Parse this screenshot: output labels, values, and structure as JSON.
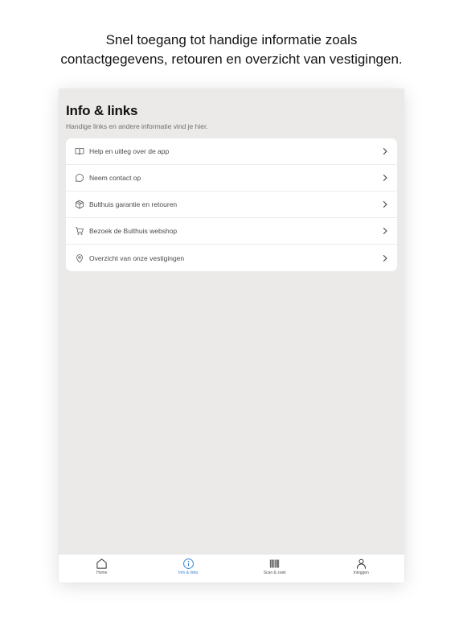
{
  "caption": {
    "line1": "Snel toegang tot handige informatie zoals",
    "line2": "contactgegevens, retouren en overzicht van vestigingen."
  },
  "page": {
    "title": "Info & links",
    "subtitle": "Handige links en andere informatie vind je hier."
  },
  "menu": {
    "items": [
      {
        "label": "Help en uitleg over de app",
        "icon": "book-icon"
      },
      {
        "label": "Neem contact op",
        "icon": "chat-bubble-icon"
      },
      {
        "label": "Bulthuis garantie en retouren",
        "icon": "package-icon"
      },
      {
        "label": "Bezoek de Bulthuis webshop",
        "icon": "cart-icon"
      },
      {
        "label": "Overzicht van onze vestigingen",
        "icon": "location-pin-icon"
      }
    ]
  },
  "tabbar": {
    "tabs": [
      {
        "label": "Home",
        "icon": "home-icon",
        "active": false
      },
      {
        "label": "Info & links",
        "icon": "info-icon",
        "active": true
      },
      {
        "label": "Scan & zoek",
        "icon": "barcode-icon",
        "active": false
      },
      {
        "label": "Inloggen",
        "icon": "user-icon",
        "active": false
      }
    ]
  },
  "colors": {
    "background": "#ebeae8",
    "card": "#ffffff",
    "accent": "#3b82d6",
    "text": "#4a4a4a"
  }
}
